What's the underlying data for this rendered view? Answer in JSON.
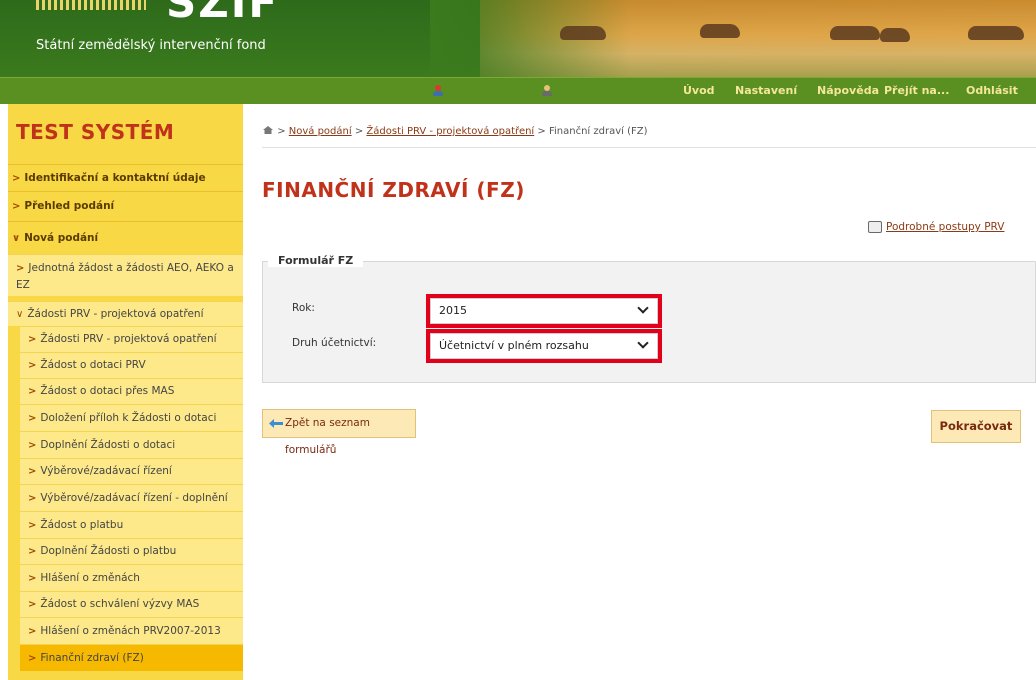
{
  "header": {
    "logo_text": "SZIF",
    "subtitle": "Státní zemědělský intervenční fond"
  },
  "nav": {
    "items": [
      "Úvod",
      "Nastavení",
      "Nápověda",
      "Přejít na...",
      "Odhlásit"
    ],
    "text_color": "#f5e79a",
    "bg_color": "#5a8f22"
  },
  "sidebar": {
    "title": "TEST SYSTÉM",
    "items": [
      {
        "label": "Identifikační a kontaktní údaje"
      },
      {
        "label": "Přehled podání"
      },
      {
        "label": "Nová podání"
      }
    ],
    "subitems": [
      {
        "label": "Jednotná žádost a žádosti AEO, AEKO a EZ"
      },
      {
        "label": "Žádosti PRV - projektová opatření"
      }
    ],
    "subsubitems": [
      {
        "label": "Žádosti PRV - projektová opatření"
      },
      {
        "label": "Žádost o dotaci PRV"
      },
      {
        "label": "Žádost o dotaci přes MAS"
      },
      {
        "label": "Doložení příloh k Žádosti o dotaci"
      },
      {
        "label": "Doplnění Žádosti o dotaci"
      },
      {
        "label": "Výběrové/zadávací řízení"
      },
      {
        "label": "Výběrové/zadávací řízení - doplnění"
      },
      {
        "label": "Žádost o platbu"
      },
      {
        "label": "Doplnění Žádosti o platbu"
      },
      {
        "label": "Hlášení o změnách"
      },
      {
        "label": "Žádost o schválení výzvy MAS"
      },
      {
        "label": "Hlášení o změnách PRV2007-2013"
      },
      {
        "label": "Finanční zdraví (FZ)"
      }
    ],
    "bg_color": "#f8d845",
    "active_color": "#f7b900"
  },
  "breadcrumb": {
    "sep": ">",
    "links": [
      "Nová podání",
      "Žádosti PRV - projektová opatření"
    ],
    "current": "Finanční zdraví (FZ)"
  },
  "page": {
    "title": "FINANČNÍ ZDRAVÍ (FZ)",
    "help_link": "Podrobné postupy PRV"
  },
  "form": {
    "legend": "Formulář FZ",
    "year_label": "Rok:",
    "year_value": "2015",
    "acct_label": "Druh účetnictví:",
    "acct_value": "Účetnictví v plném rozsahu"
  },
  "buttons": {
    "back": "Zpět na seznam formulářů",
    "continue": "Pokračovat"
  },
  "colors": {
    "accent_red": "#c0321a",
    "highlight": "#e2001a"
  }
}
